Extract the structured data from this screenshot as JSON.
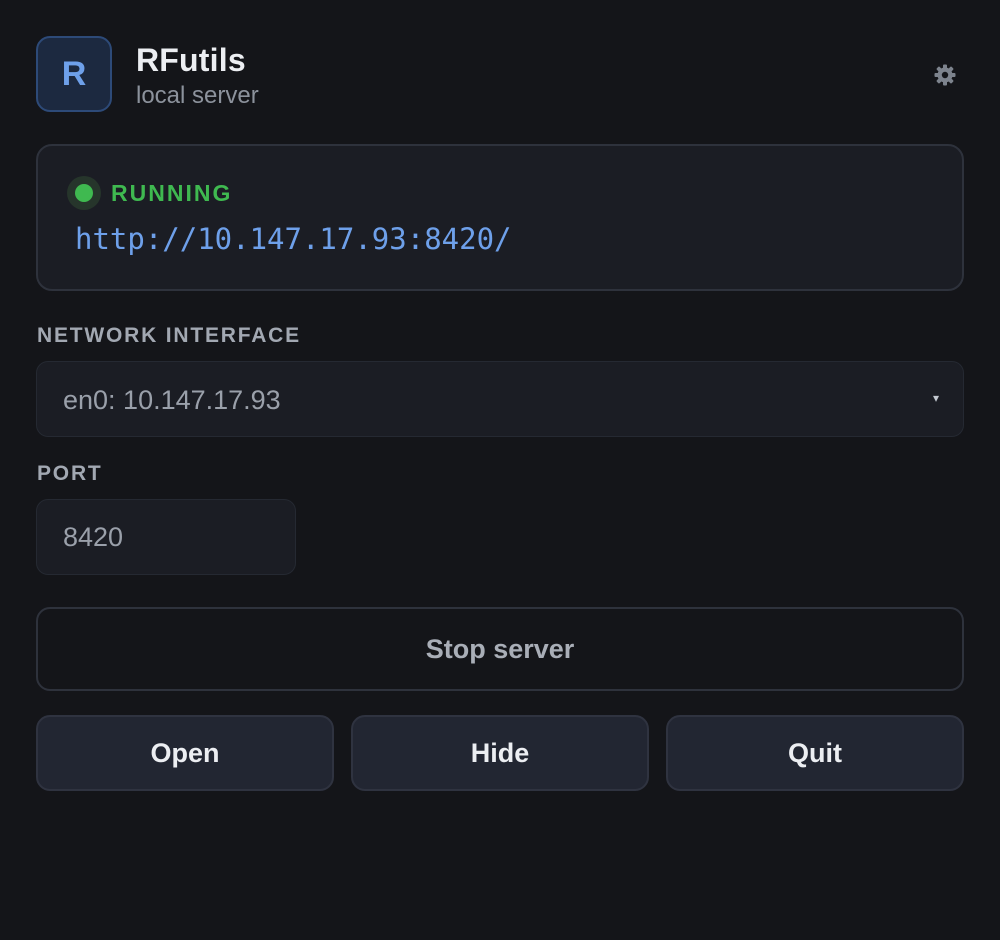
{
  "app": {
    "icon_letter": "R",
    "title": "RFutils",
    "subtitle": "local server",
    "settings_icon": "gear-icon"
  },
  "status": {
    "state": "RUNNING",
    "color": "#3fb950",
    "url": "http://10.147.17.93:8420/"
  },
  "network": {
    "label": "NETWORK INTERFACE",
    "selected": "en0: 10.147.17.93",
    "caret": "▾"
  },
  "port": {
    "label": "PORT",
    "value": "8420"
  },
  "actions": {
    "stop_label": "Stop server",
    "open_label": "Open",
    "hide_label": "Hide",
    "quit_label": "Quit"
  },
  "colors": {
    "background": "#141519",
    "card": "#1b1d24",
    "accent_blue": "#6ea0ea",
    "running_green": "#3fb950"
  }
}
